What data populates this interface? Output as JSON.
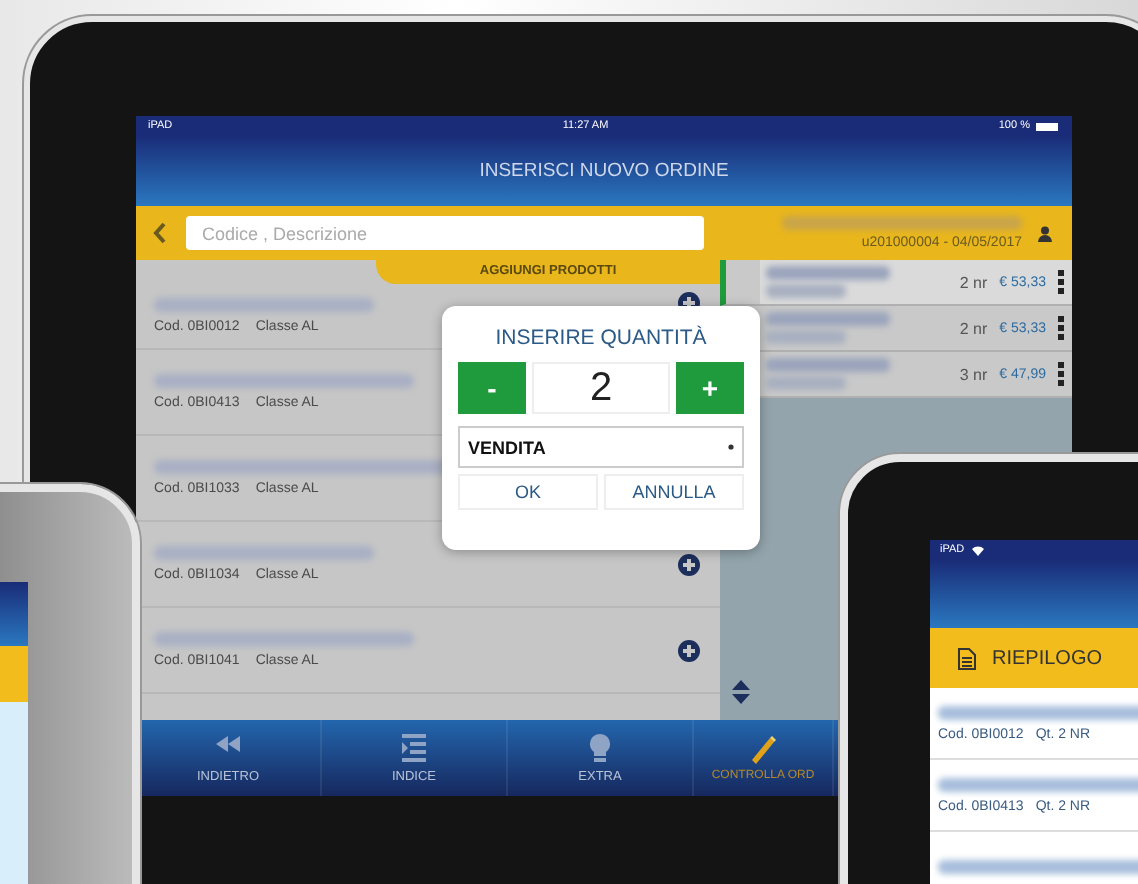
{
  "main_tablet": {
    "status_bar": {
      "carrier": "iPAD",
      "time": "11:27 AM",
      "battery": "100 %"
    },
    "title": "INSERISCI NUOVO ORDINE",
    "search": {
      "placeholder": "Codice , Descrizione"
    },
    "add_products_tab": "AGGIUNGI PRODOTTI",
    "products": [
      {
        "code": "Cod. 0BI0012",
        "class": "Classe AL"
      },
      {
        "code": "Cod. 0BI0413",
        "class": "Classe AL"
      },
      {
        "code": "Cod. 0BI1033",
        "class": "Classe AL"
      },
      {
        "code": "Cod. 0BI1034",
        "class": "Classe AL"
      },
      {
        "code": "Cod. 0BI1041",
        "class": "Classe AL"
      }
    ],
    "order": {
      "reference": "u201000004 - 04/05/2017",
      "lines": [
        {
          "quantity": "2 nr",
          "price": "€ 53,33",
          "selected": true
        },
        {
          "quantity": "2 nr",
          "price": "€ 53,33",
          "selected": false
        },
        {
          "quantity": "3 nr",
          "price": "€ 47,99",
          "selected": false
        }
      ]
    },
    "dialog": {
      "title": "INSERIRE QUANTITÀ",
      "minus": "-",
      "quantity": "2",
      "plus": "+",
      "type": "VENDITA",
      "ok": "OK",
      "cancel": "ANNULLA"
    },
    "nav": [
      {
        "label": "INDIETRO",
        "kind": "back",
        "selected": false
      },
      {
        "label": "INDICE",
        "kind": "index",
        "selected": false
      },
      {
        "label": "EXTRA",
        "kind": "extra",
        "selected": false
      },
      {
        "label": "CONTROLLA ORD",
        "kind": "check",
        "selected": true
      }
    ]
  },
  "right_tablet": {
    "status_bar": {
      "carrier": "iPAD"
    },
    "title": "RIEPILOGO",
    "items": [
      {
        "code": "Cod. 0BI0012",
        "quantity": "Qt. 2 NR"
      },
      {
        "code": "Cod. 0BI0413",
        "quantity": "Qt. 2 NR"
      }
    ]
  }
}
